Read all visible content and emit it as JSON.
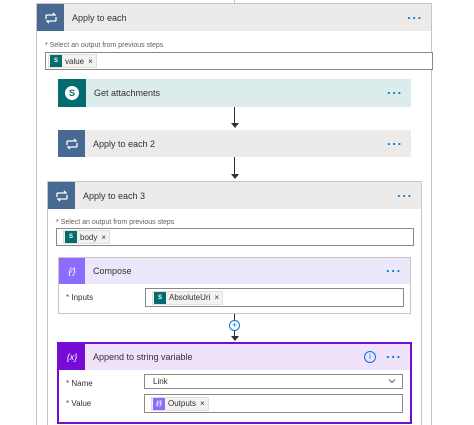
{
  "apply_each_1": {
    "title": "Apply to each",
    "select_label": "Select an output from previous steps",
    "token_label": "value",
    "token_remove": "×",
    "more": "···"
  },
  "get_attachments": {
    "title": "Get attachments",
    "icon_letter": "S",
    "more": "···"
  },
  "apply_each_2": {
    "title": "Apply to each 2",
    "more": "···"
  },
  "apply_each_3": {
    "title": "Apply to each 3",
    "select_label": "Select an output from previous steps",
    "token_label": "body",
    "token_remove": "×",
    "more": "···"
  },
  "compose": {
    "title": "Compose",
    "icon_glyph": "{⁄}",
    "inputs_label": "Inputs",
    "token_label": "AbsoluteUri",
    "token_remove": "×",
    "more": "···"
  },
  "add_step": {
    "glyph": "+"
  },
  "append_var": {
    "title": "Append to string variable",
    "icon_glyph": "{x}",
    "info_glyph": "i",
    "more": "···",
    "name_label": "Name",
    "name_value": "Link",
    "value_label": "Value",
    "token_label": "Outputs",
    "token_remove": "×"
  },
  "required_mark": "*",
  "colors": {
    "loop_gray": "#486991",
    "sharepoint_teal": "#036c70",
    "compose_purple": "#8c6cff",
    "variable_purple": "#770bd6",
    "accent": "#0078d4"
  }
}
